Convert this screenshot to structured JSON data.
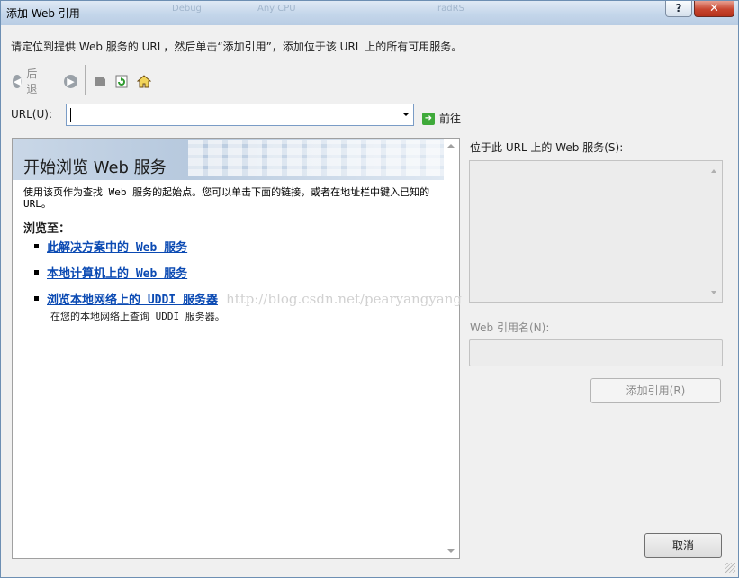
{
  "window": {
    "title": "添加 Web 引用",
    "help_glyph": "?",
    "close_glyph": "✕",
    "ghost_tabs": [
      "Debug",
      "Any CPU",
      "radRS"
    ]
  },
  "instruction": "请定位到提供 Web 服务的 URL，然后单击“添加引用”，添加位于该 URL 上的所有可用服务。",
  "toolbar": {
    "back_label": "后退",
    "icons": [
      "back-icon",
      "forward-icon",
      "stop-icon",
      "refresh-icon",
      "home-icon"
    ]
  },
  "url": {
    "label": "URL(U):",
    "value": "",
    "go_label": "前往"
  },
  "browser": {
    "title": "开始浏览 Web 服务",
    "description": "使用该页作为查找 Web 服务的起始点。您可以单击下面的链接，或者在地址栏中键入已知的 URL。",
    "browse_to": "浏览至：",
    "links": [
      {
        "label": "此解决方案中的 Web 服务"
      },
      {
        "label": "本地计算机上的 Web 服务"
      },
      {
        "label": "浏览本地网络上的 UDDI 服务器",
        "sub": "在您的本地网络上查询 UDDI 服务器。"
      }
    ]
  },
  "services": {
    "label": "位于此 URL 上的 Web 服务(S):"
  },
  "reference": {
    "label": "Web 引用名(N):",
    "value": ""
  },
  "buttons": {
    "add": "添加引用(R)",
    "cancel": "取消"
  },
  "watermark": "http://blog.csdn.net/pearyangyang",
  "colors": {
    "link": "#0b4ab3",
    "close": "#c7452f",
    "go": "#3faa3a"
  }
}
